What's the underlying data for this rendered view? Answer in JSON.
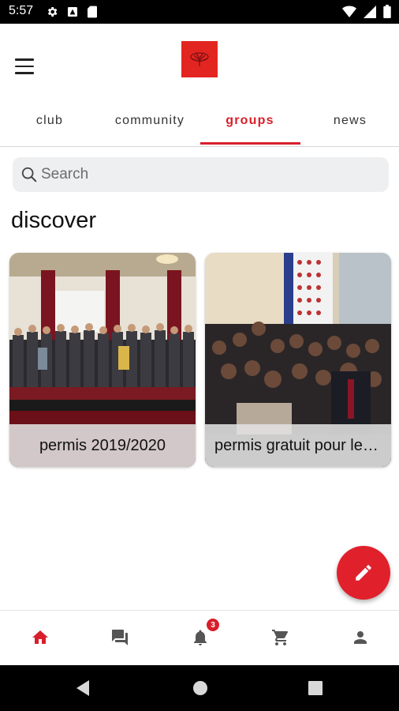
{
  "status_bar": {
    "time": "5:57"
  },
  "tabs": [
    {
      "label": "club",
      "active": false
    },
    {
      "label": "community",
      "active": false
    },
    {
      "label": "groups",
      "active": true
    },
    {
      "label": "news",
      "active": false
    }
  ],
  "search": {
    "placeholder": "Search"
  },
  "section": {
    "title": "discover"
  },
  "cards": [
    {
      "title": "permis 2019/2020"
    },
    {
      "title": "permis gratuit pour les jeunes"
    }
  ],
  "bottom_nav": {
    "notification_count": "3"
  },
  "colors": {
    "accent": "#d81e2b",
    "fab": "#e0212c",
    "logo": "#e32521"
  },
  "icons": {
    "status_left": [
      "gear-icon",
      "sim-icon",
      "sd-card-icon"
    ],
    "status_right": [
      "wifi-icon",
      "signal-icon",
      "battery-icon"
    ],
    "bottom_nav": [
      "home-icon",
      "chat-icon",
      "bell-icon",
      "cart-icon",
      "person-icon"
    ],
    "fab": "pencil-icon",
    "system_nav": [
      "back-icon",
      "home-circle-icon",
      "recents-icon"
    ]
  }
}
